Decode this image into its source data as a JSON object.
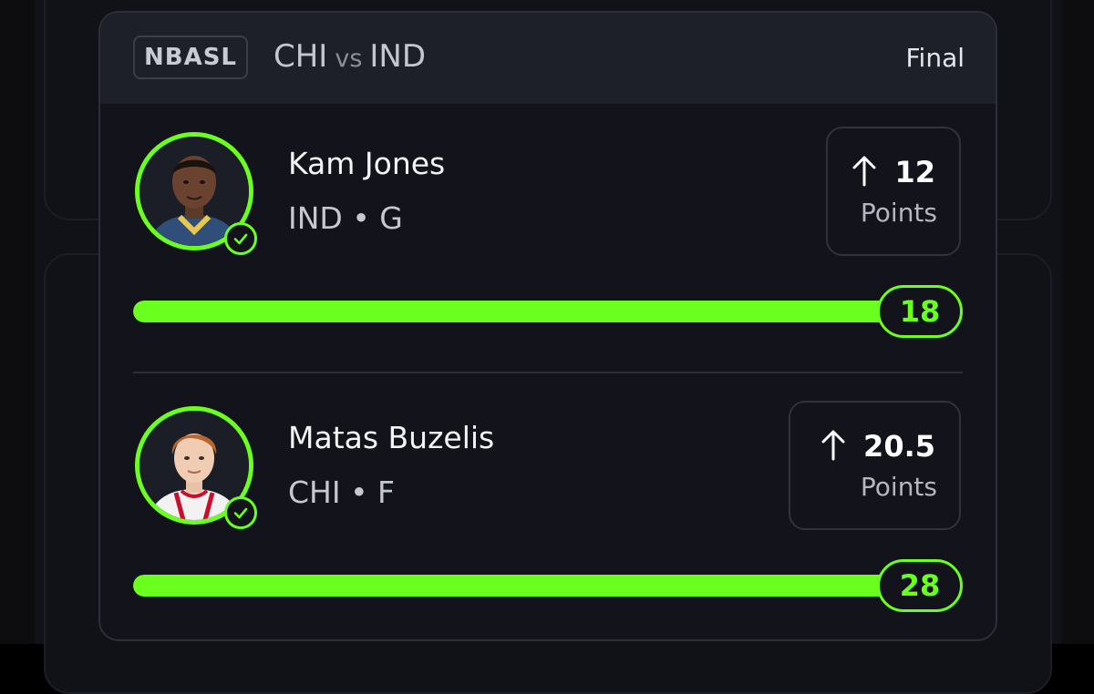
{
  "game": {
    "league": "NBASL",
    "team_a": "CHI",
    "vs_label": "vs",
    "team_b": "IND",
    "status": "Final"
  },
  "picks": [
    {
      "name": "Kam Jones",
      "meta": "IND • G",
      "direction_icon": "arrow-up-icon",
      "line": "12",
      "stat": "Points",
      "result": "18",
      "progress_fraction": 1.0,
      "status_icon": "check-icon"
    },
    {
      "name": "Matas Buzelis",
      "meta": "CHI • F",
      "direction_icon": "arrow-up-icon",
      "line": "20.5",
      "stat": "Points",
      "result": "28",
      "progress_fraction": 1.0,
      "status_icon": "check-icon"
    }
  ],
  "colors": {
    "accent": "#6bff1f",
    "card_bg": "#12131b",
    "header_bg": "#1d2029"
  }
}
